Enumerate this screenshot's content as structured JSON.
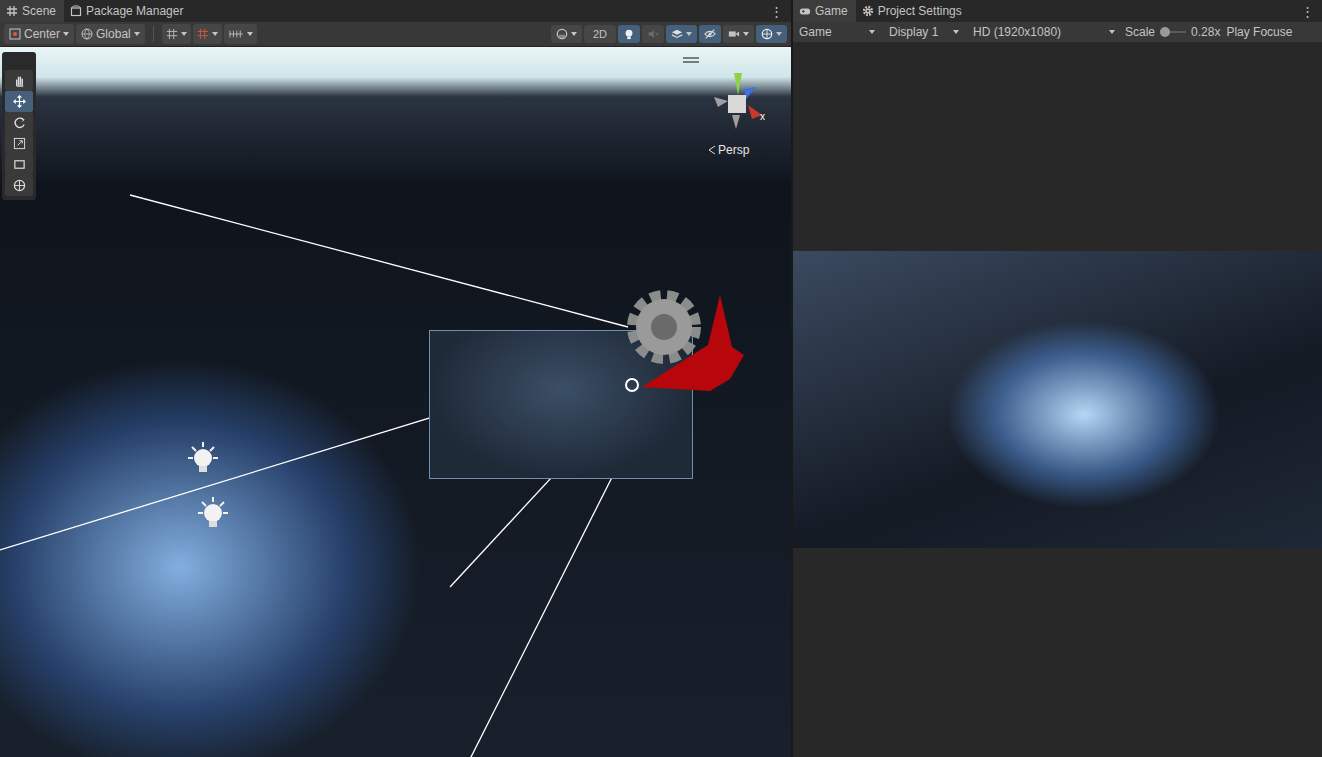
{
  "scene_panel": {
    "tabs": [
      {
        "label": "Scene",
        "selected": true,
        "kind": "scene"
      },
      {
        "label": "Package Manager",
        "selected": false,
        "kind": "package"
      }
    ],
    "menu": "⋮",
    "toolbar": {
      "pivot": {
        "label": "Center"
      },
      "space": {
        "label": "Global"
      },
      "snapping": [
        {
          "kind": "grid"
        },
        {
          "kind": "snap"
        },
        {
          "kind": "ruler"
        }
      ],
      "view_toggles": [
        {
          "kind": "shading",
          "on": false,
          "dropdown": true,
          "label": ""
        },
        {
          "kind": "2d",
          "on": false,
          "dropdown": false,
          "label": "2D"
        },
        {
          "kind": "lighting",
          "on": true,
          "dropdown": false,
          "label": ""
        },
        {
          "kind": "audio",
          "on": false,
          "dropdown": false,
          "label": ""
        },
        {
          "kind": "effects",
          "on": true,
          "dropdown": true,
          "label": ""
        },
        {
          "kind": "visibility",
          "on": true,
          "dropdown": false,
          "label": ""
        },
        {
          "kind": "camera",
          "on": false,
          "dropdown": true,
          "label": ""
        },
        {
          "kind": "gizmos",
          "on": true,
          "dropdown": true,
          "label": ""
        }
      ]
    },
    "tools": [
      {
        "kind": "hand",
        "selected": false
      },
      {
        "kind": "move",
        "selected": true
      },
      {
        "kind": "rotate",
        "selected": false
      },
      {
        "kind": "scale",
        "selected": false
      },
      {
        "kind": "rect",
        "selected": false
      },
      {
        "kind": "transform",
        "selected": false
      }
    ],
    "view": {
      "axis_label": "x",
      "projection": "Persp"
    }
  },
  "game_panel": {
    "tabs": [
      {
        "label": "Game",
        "selected": true,
        "kind": "game"
      },
      {
        "label": "Project Settings",
        "selected": false,
        "kind": "settings"
      }
    ],
    "menu": "⋮",
    "toolbar": {
      "view": "Game",
      "display": "Display 1",
      "resolution": "HD (1920x1080)",
      "scale_label": "Scale",
      "scale_level": 0.2,
      "scale_value": "0.28x",
      "play_mode": "Play Focuse"
    }
  }
}
